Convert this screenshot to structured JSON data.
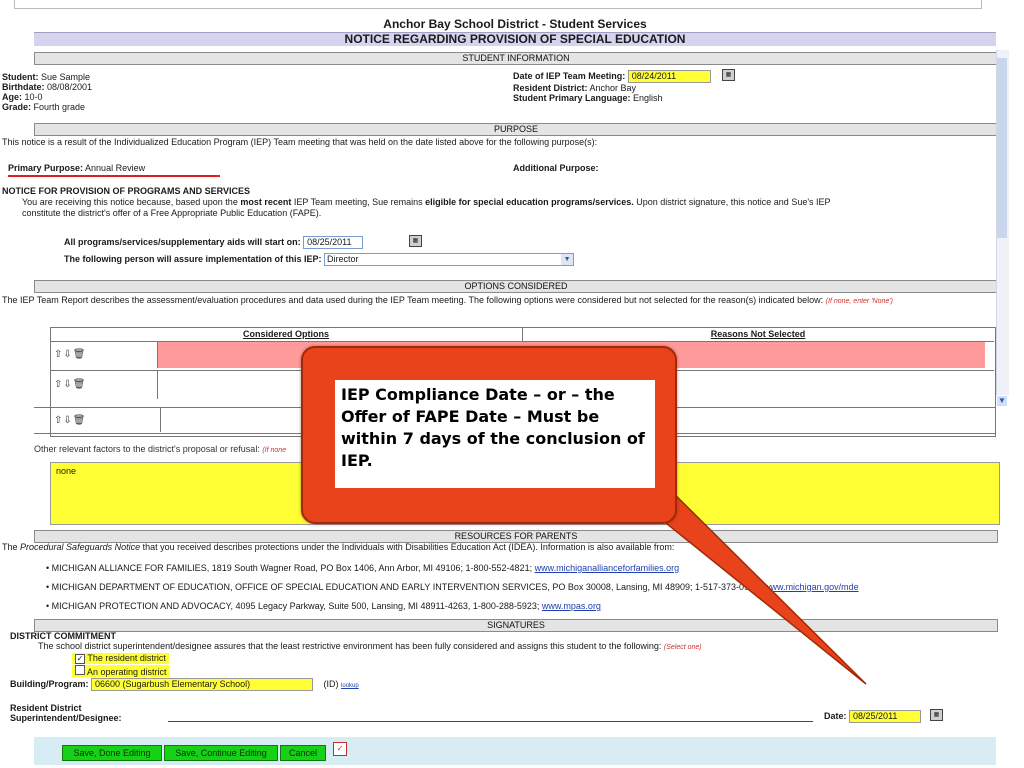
{
  "header": {
    "district_title": "Anchor Bay School District - Student Services",
    "notice_title": "NOTICE REGARDING PROVISION OF SPECIAL EDUCATION"
  },
  "student_info": {
    "section_label": "STUDENT INFORMATION",
    "student_label": "Student:",
    "student_value": "Sue Sample",
    "birthdate_label": "Birthdate:",
    "birthdate_value": "08/08/2001",
    "age_label": "Age:",
    "age_value": "10-0",
    "grade_label": "Grade:",
    "grade_value": "Fourth grade",
    "meeting_date_label": "Date of IEP Team Meeting:",
    "meeting_date_value": "08/24/2011",
    "resident_district_label": "Resident District:",
    "resident_district_value": "Anchor Bay",
    "language_label": "Student Primary Language:",
    "language_value": "English"
  },
  "purpose": {
    "section_label": "PURPOSE",
    "intro": "This notice is a result of the Individualized Education Program (IEP) Team meeting that was held on the date listed above for the following purpose(s):",
    "primary_label": "Primary Purpose:",
    "primary_value": "Annual Review",
    "additional_label": "Additional Purpose:"
  },
  "notice": {
    "heading": "NOTICE FOR PROVISION OF PROGRAMS AND SERVICES",
    "text_a": "You are receiving this notice because, based upon the",
    "text_b": "most recent",
    "text_c": "IEP Team meeting, Sue remains",
    "text_d": "eligible for special education programs/services.",
    "text_e": "Upon district signature, this notice and Sue's IEP",
    "text_line2": "constitute the district's offer of a Free Appropriate Public Education (FAPE).",
    "start_label": "All programs/services/supplementary aids will start on:",
    "start_value": "08/25/2011",
    "assure_label": "The following person will assure implementation of this IEP:",
    "assure_value": "Director"
  },
  "options": {
    "section_label": "OPTIONS CONSIDERED",
    "intro": "The IEP Team Report describes the assessment/evaluation procedures and data used during the IEP Team meeting. The following options were considered but not selected for the reason(s) indicated below:",
    "intro_hint": "(If none, enter 'None')",
    "col_considered": "Considered Options",
    "col_reasons": "Reasons Not Selected",
    "other_label": "Other relevant factors to the district's proposal or refusal:",
    "other_hint": "(If none",
    "other_value": "none"
  },
  "callout": {
    "text": "IEP Compliance Date – or – the Offer of FAPE Date – Must be within 7 days of the conclusion of IEP."
  },
  "resources": {
    "section_label": "RESOURCES FOR PARENTS",
    "intro_a": "The",
    "intro_b": "Procedural Safeguards Notice",
    "intro_c": "that you received describes protections under the Individuals with Disabilities Education Act (IDEA). Information is also available from:",
    "items": [
      {
        "text": "MICHIGAN ALLIANCE FOR FAMILIES, 1819 South Wagner Road, PO Box 1406, Ann Arbor, MI 49106; 1-800-552-4821;",
        "link": "www.michiganallianceforfamilies.org"
      },
      {
        "text": "MICHIGAN DEPARTMENT OF EDUCATION, OFFICE OF SPECIAL EDUCATION AND EARLY INTERVENTION SERVICES, PO Box 30008, Lansing, MI 48909; 1-517-373-0923;",
        "link": "www.michigan.gov/mde"
      },
      {
        "text": "MICHIGAN PROTECTION AND ADVOCACY, 4095 Legacy Parkway, Suite 500, Lansing, MI 48911-4263, 1-800-288-5923;",
        "link": "www.mpas.org"
      }
    ]
  },
  "signatures": {
    "section_label": "SIGNATURES",
    "commitment_heading": "DISTRICT COMMITMENT",
    "commitment_text": "The school district superintendent/designee assures that the least restrictive environment has been fully considered and assigns this student to the following:",
    "commitment_hint": "(Select one)",
    "option_resident": "The resident district",
    "option_operating": "An operating district",
    "building_label": "Building/Program:",
    "building_value": "06600 (Sugarbush Elementary School)",
    "id_label": "(ID)",
    "lookup_label": "lookup",
    "superintendent_label_1": "Resident District",
    "superintendent_label_2": "Superintendent/Designee:",
    "date_label": "Date:",
    "date_value": "08/25/2011"
  },
  "footer": {
    "save_done": "Save, Done Editing",
    "save_continue": "Save, Continue Editing",
    "cancel": "Cancel"
  },
  "colors": {
    "callout": "#e8431a",
    "highlight": "#ffff33",
    "pink_row": "#ff9b9b",
    "button": "#17d117",
    "underline": "#e02020"
  }
}
